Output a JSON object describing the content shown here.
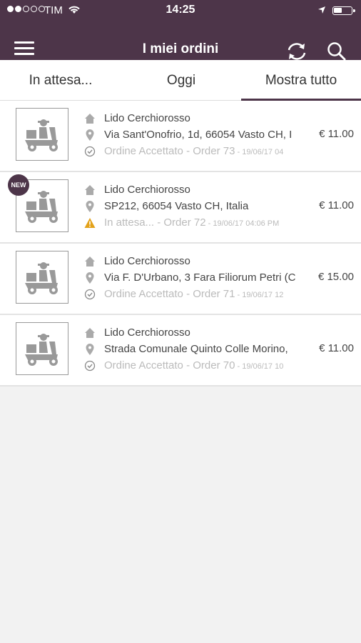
{
  "status_bar": {
    "carrier": "TIM",
    "time": "14:25"
  },
  "header": {
    "title": "I miei ordini"
  },
  "tabs": [
    {
      "label": "In attesa...",
      "active": false
    },
    {
      "label": "Oggi",
      "active": false
    },
    {
      "label": "Mostra tutto",
      "active": true
    }
  ],
  "orders": [
    {
      "name": "Lido Cerchiorosso",
      "address": "Via Sant'Onofrio, 1d, 66054 Vasto CH, I",
      "status": "Ordine Accettato - Order 73",
      "timestamp": " - 19/06/17 04",
      "price": "€ 11.00",
      "is_new": false,
      "status_icon": "check-circle-icon"
    },
    {
      "name": "Lido Cerchiorosso",
      "address": "SP212, 66054 Vasto CH, Italia",
      "status": "In attesa... - Order 72",
      "timestamp": " - 19/06/17 04:06 PM",
      "price": "€ 11.00",
      "is_new": true,
      "new_label": "NEW",
      "status_icon": "warning-icon"
    },
    {
      "name": "Lido Cerchiorosso",
      "address": "Via F. D'Urbano, 3 Fara Filiorum Petri (C",
      "status": "Ordine Accettato - Order 71",
      "timestamp": " - 19/06/17 12",
      "price": "€ 15.00",
      "is_new": false,
      "status_icon": "check-circle-icon"
    },
    {
      "name": "Lido Cerchiorosso",
      "address": "Strada Comunale Quinto Colle Morino,",
      "status": "Ordine Accettato - Order 70",
      "timestamp": " - 19/06/17 10",
      "price": "€ 11.00",
      "is_new": false,
      "status_icon": "check-circle-icon"
    }
  ],
  "colors": {
    "brand": "#4d3549",
    "warning": "#e3a21a",
    "icon_gray": "#aaaaaa"
  }
}
